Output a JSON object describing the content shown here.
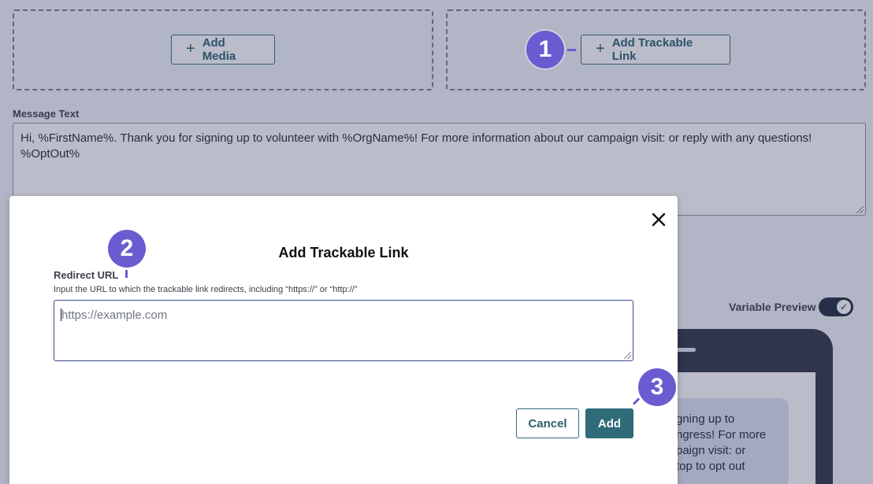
{
  "top_actions": {
    "add_media_label": "Add Media",
    "add_trackable_link_label": "Add Trackable Link",
    "plus_glyph": "+"
  },
  "message": {
    "label": "Message Text",
    "text": "Hi, %FirstName%. Thank you for signing up to volunteer with %OrgName%! For more information about our campaign visit: or reply with any questions! %OptOut%"
  },
  "preview": {
    "toggle_label": "Variable Preview",
    "toggle_on": true,
    "toggle_glyph": "✓",
    "bubble_lines": [
      "gning up to",
      "ngress! For more",
      "paign visit: or",
      "top to opt out"
    ]
  },
  "dialog": {
    "title": "Add Trackable Link",
    "close_glyph": "✕",
    "field_label": "Redirect URL",
    "field_help": "Input the URL to which the trackable link redirects, including “https://” or “http://”",
    "input_placeholder": "https://example.com",
    "cancel_label": "Cancel",
    "add_label": "Add"
  },
  "callouts": [
    "1",
    "2",
    "3"
  ],
  "colors": {
    "accent_teal": "#2f6b78",
    "callout_purple": "#6b5bd0",
    "overlay": "rgba(52,58,100,0.34)",
    "toggle_dark": "#1e2a3a"
  },
  "icons": {
    "add_media": "plus-icon",
    "add_link": "plus-icon",
    "close": "close-icon",
    "toggle_check": "check-icon"
  }
}
